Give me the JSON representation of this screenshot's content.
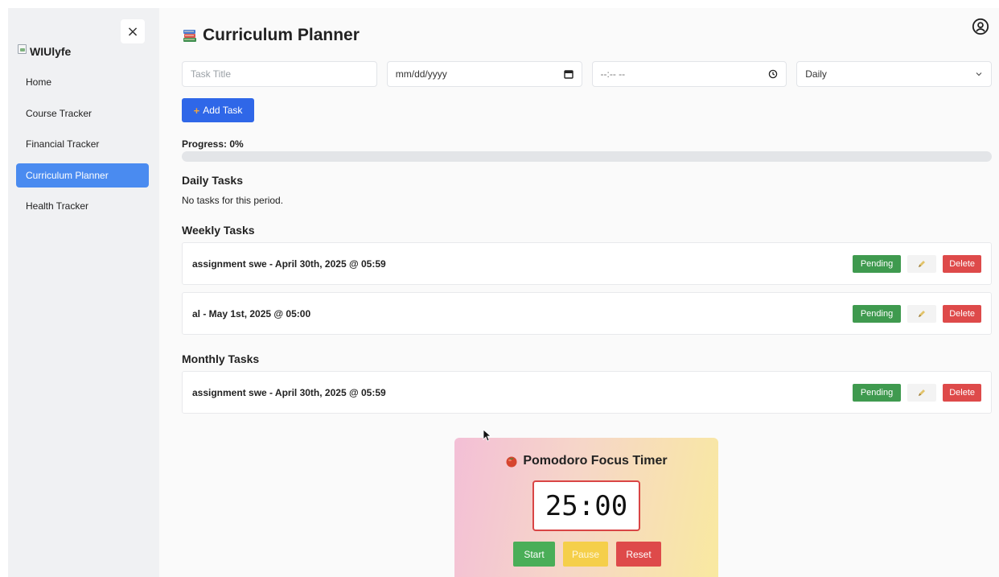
{
  "sidebar": {
    "brand_name": "WIUlyfe",
    "close_symbol": "×",
    "items": [
      {
        "label": "Home",
        "active": false
      },
      {
        "label": "Course Tracker",
        "active": false
      },
      {
        "label": "Financial Tracker",
        "active": false
      },
      {
        "label": "Curriculum Planner",
        "active": true
      },
      {
        "label": "Health Tracker",
        "active": false
      }
    ]
  },
  "header": {
    "title": "Curriculum Planner",
    "title_icon": "books-icon",
    "user_icon": "user-circle-icon"
  },
  "form": {
    "title_placeholder": "Task Title",
    "date_placeholder": "mm/dd/yyyy",
    "time_placeholder": "--:-- --",
    "frequency_value": "Daily",
    "add_button_label": "Add Task",
    "add_button_symbol": "+"
  },
  "progress": {
    "label": "Progress: 0%",
    "percent": 0
  },
  "sections": {
    "daily": {
      "title": "Daily Tasks",
      "empty_text": "No tasks for this period."
    },
    "weekly": {
      "title": "Weekly Tasks",
      "tasks": [
        {
          "text": "assignment swe - April 30th, 2025 @ 05:59"
        },
        {
          "text": "al - May 1st, 2025 @ 05:00"
        }
      ]
    },
    "monthly": {
      "title": "Monthly Tasks",
      "tasks": [
        {
          "text": "assignment swe - April 30th, 2025 @ 05:59"
        }
      ]
    }
  },
  "task_actions": {
    "status_label": "Pending",
    "edit_icon": "pencil-icon",
    "delete_label": "Delete"
  },
  "pomodoro": {
    "title": "Pomodoro Focus Timer",
    "icon": "tomato-icon",
    "time": "25:00",
    "start_label": "Start",
    "pause_label": "Pause",
    "reset_label": "Reset"
  },
  "colors": {
    "accent_blue": "#2f67e8",
    "nav_active": "#4a8bf0",
    "pending_green": "#3f9a4f",
    "delete_red": "#de4a4a",
    "pause_yellow": "#f5cf4a"
  }
}
